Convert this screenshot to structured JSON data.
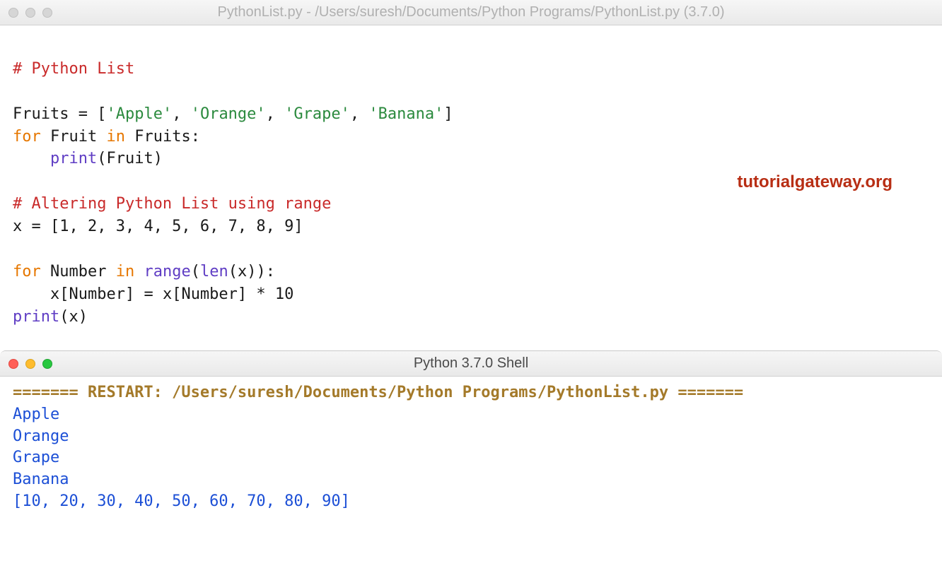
{
  "editor_window": {
    "title": "PythonList.py - /Users/suresh/Documents/Python Programs/PythonList.py (3.7.0)",
    "code": {
      "l1_comment": "# Python List",
      "l2_blank": "",
      "l3": {
        "var": "Fruits",
        "eq": " = ",
        "lb": "[",
        "s1": "'Apple'",
        "c1": ", ",
        "s2": "'Orange'",
        "c2": ", ",
        "s3": "'Grape'",
        "c3": ", ",
        "s4": "'Banana'",
        "rb": "]"
      },
      "l4": {
        "kw_for": "for",
        "sp1": " ",
        "var": "Fruit",
        "sp2": " ",
        "kw_in": "in",
        "sp3": " ",
        "iter": "Fruits",
        "colon": ":"
      },
      "l5": {
        "indent": "    ",
        "func": "print",
        "lp": "(",
        "arg": "Fruit",
        "rp": ")"
      },
      "l6_blank": "",
      "l7_comment": "# Altering Python List using range",
      "l8": {
        "var": "x",
        "eq": " = ",
        "list": "[1, 2, 3, 4, 5, 6, 7, 8, 9]"
      },
      "l9_blank": "",
      "l10": {
        "kw_for": "for",
        "sp1": " ",
        "var": "Number",
        "sp2": " ",
        "kw_in": "in",
        "sp3": " ",
        "func": "range",
        "lp": "(",
        "len": "len",
        "lp2": "(",
        "arg": "x",
        "rp2": ")",
        "rp": ")",
        "colon": ":"
      },
      "l11": {
        "indent": "    ",
        "lhs": "x[Number]",
        "eq": " = ",
        "rhs": "x[Number] * 10"
      },
      "l12": {
        "func": "print",
        "lp": "(",
        "arg": "x",
        "rp": ")"
      }
    }
  },
  "watermark": "tutorialgateway.org",
  "shell_window": {
    "title": "Python 3.7.0 Shell",
    "banner": "======= RESTART: /Users/suresh/Documents/Python Programs/PythonList.py =======",
    "output": {
      "o1": "Apple",
      "o2": "Orange",
      "o3": "Grape",
      "o4": "Banana",
      "o5": "[10, 20, 30, 40, 50, 60, 70, 80, 90]"
    }
  }
}
